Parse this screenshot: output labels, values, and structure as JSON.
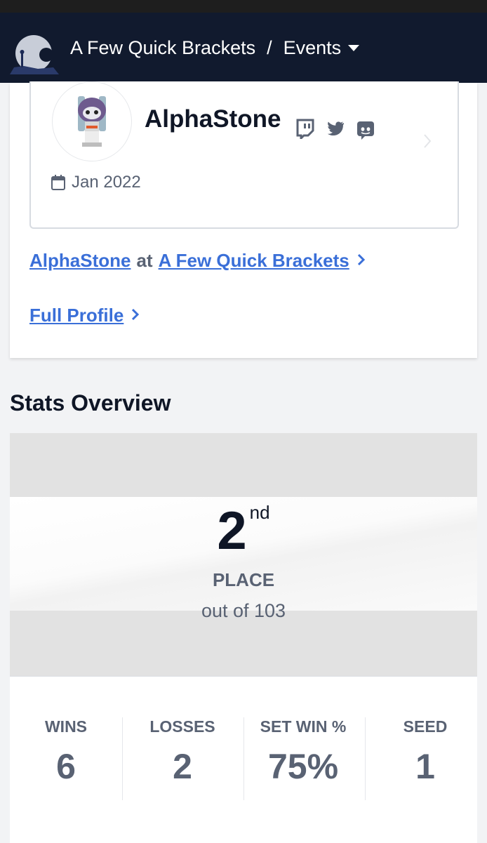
{
  "nav": {
    "site_title": "A Few Quick Brackets",
    "separator": "/",
    "events_label": "Events"
  },
  "player": {
    "name": "AlphaStone",
    "joined": "Jan 2022",
    "social_icons": [
      "twitch-icon",
      "twitter-icon",
      "discord-icon"
    ]
  },
  "links": {
    "player_link": "AlphaStone",
    "at_text": "at",
    "org_link": "A Few Quick Brackets",
    "full_profile": "Full Profile"
  },
  "stats": {
    "title": "Stats Overview",
    "place": "2",
    "place_suffix": "nd",
    "place_label": "PLACE",
    "out_of": "out of 103",
    "columns": [
      {
        "label": "WINS",
        "value": "6"
      },
      {
        "label": "LOSSES",
        "value": "2"
      },
      {
        "label": "SET WIN %",
        "value": "75%"
      },
      {
        "label": "SEED",
        "value": "1"
      }
    ]
  },
  "colors": {
    "nav_bg": "#111a2e",
    "link": "#3a6fd8",
    "muted_text": "#596273"
  }
}
